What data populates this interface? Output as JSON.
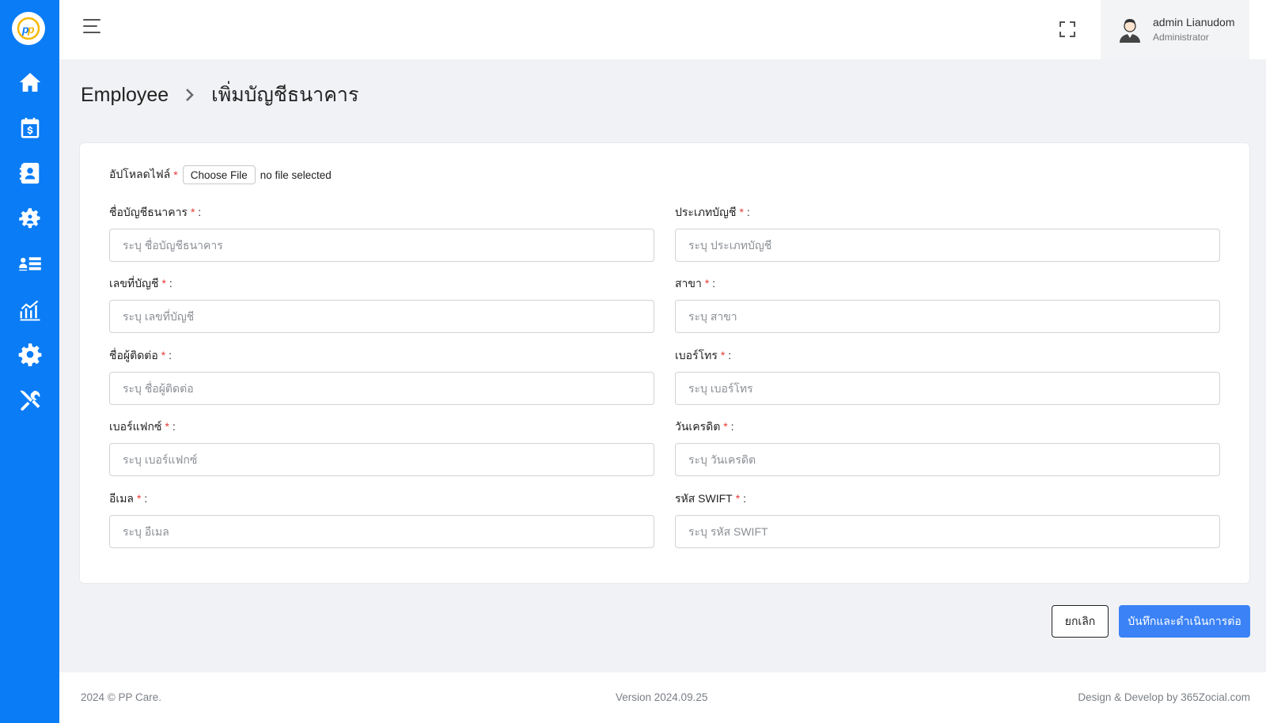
{
  "sidebar": {
    "logo_icon": "pp-care-logo",
    "items": [
      {
        "icon": "home-icon"
      },
      {
        "icon": "calendar-dollar-icon"
      },
      {
        "icon": "contact-book-icon"
      },
      {
        "icon": "team-gear-icon"
      },
      {
        "icon": "user-list-icon"
      },
      {
        "icon": "analytics-chart-icon"
      },
      {
        "icon": "settings-gear-icon"
      },
      {
        "icon": "tools-icon"
      }
    ],
    "color": "#0a7cf5"
  },
  "header": {
    "user_name": "admin Lianudom",
    "user_role": "Administrator"
  },
  "breadcrumb": {
    "parent": "Employee",
    "current": "เพิ่มบัญชีธนาคาร"
  },
  "form": {
    "upload_label": "อัปโหลดไฟล์",
    "required_mark": "*",
    "choose_file": "Choose File",
    "file_status": "no file selected",
    "fields": [
      {
        "label": "ชื่อบัญชีธนาคาร",
        "placeholder": "ระบุ ชื่อบัญชีธนาคาร",
        "value": ""
      },
      {
        "label": "ประเภทบัญชี",
        "placeholder": "ระบุ ประเภทบัญชี",
        "value": ""
      },
      {
        "label": "เลขที่บัญชี",
        "placeholder": "ระบุ เลขที่บัญชี",
        "value": ""
      },
      {
        "label": "สาขา",
        "placeholder": "ระบุ สาขา",
        "value": ""
      },
      {
        "label": "ชื่อผู้ติดต่อ",
        "placeholder": "ระบุ ชื่อผู้ติดต่อ",
        "value": ""
      },
      {
        "label": "เบอร์โทร",
        "placeholder": "ระบุ เบอร์โทร",
        "value": ""
      },
      {
        "label": "เบอร์แฟกซ์",
        "placeholder": "ระบุ เบอร์แฟกซ์",
        "value": ""
      },
      {
        "label": "วันเครดิต",
        "placeholder": "ระบุ วันเครดิต",
        "value": ""
      },
      {
        "label": "อีเมล",
        "placeholder": "ระบุ อีเมล",
        "value": ""
      },
      {
        "label": "รหัส SWIFT",
        "placeholder": "ระบุ รหัส SWIFT",
        "value": ""
      }
    ]
  },
  "actions": {
    "cancel": "ยกเลิก",
    "save": "บันทึกและดำเนินการต่อ",
    "primary_color": "#3b82f6"
  },
  "footer": {
    "copyright": "2024 © PP Care.",
    "version": "Version 2024.09.25",
    "credit": "Design & Develop by 365Zocial.com"
  }
}
